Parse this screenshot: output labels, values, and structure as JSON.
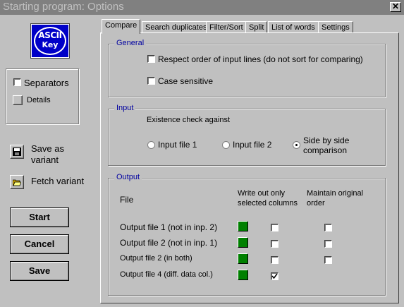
{
  "window": {
    "title": "Starting program: Options",
    "close_glyph": "✕"
  },
  "logo": {
    "line1": "ASCII",
    "line2": "Key"
  },
  "left": {
    "separators_label": "Separators",
    "details_label": "Details",
    "save_variant_label_1": "Save as",
    "save_variant_label_2": "variant",
    "fetch_variant_label": "Fetch variant",
    "start_label": "Start",
    "cancel_label": "Cancel",
    "save_label": "Save"
  },
  "tabs": [
    "Compare",
    "Search duplicates",
    "Filter/Sort",
    "Split",
    "List of words",
    "Settings"
  ],
  "general": {
    "legend": "General",
    "respect_order_label": "Respect order of input lines (do not sort for comparing)",
    "case_sensitive_label": "Case sensitive"
  },
  "input": {
    "legend": "Input",
    "existence_label": "Existence check against",
    "radio1_label": "Input file 1",
    "radio2_label": "Input file 2",
    "radio3_label_1": "Side by side",
    "radio3_label_2": "comparison",
    "selected": "side-by-side"
  },
  "output": {
    "legend": "Output",
    "col_file": "File",
    "col_write_1": "Write out only",
    "col_write_2": "selected columns",
    "col_maintain_1": "Maintain original",
    "col_maintain_2": "order",
    "rows": [
      {
        "label": "Output file 1 (not in inp. 2)",
        "write_selected": false,
        "maintain_order": false
      },
      {
        "label": "Output file 2 (not in inp. 1)",
        "write_selected": false,
        "maintain_order": false
      },
      {
        "label": "Output file 2 (in both)",
        "write_selected": false,
        "maintain_order": false
      },
      {
        "label": "Output file 4 (diff. data col.)",
        "write_selected": true,
        "maintain_order": null
      }
    ]
  },
  "colors": {
    "face": "#c0c0c0",
    "title_bar": "#808080",
    "legend_text": "#0000a0",
    "output_button": "#008000",
    "logo_bg": "#0000c8"
  },
  "icons": {
    "save_variant": "floppy-disk-icon",
    "fetch_variant": "open-folder-icon",
    "output_file": "green-square-icon"
  }
}
